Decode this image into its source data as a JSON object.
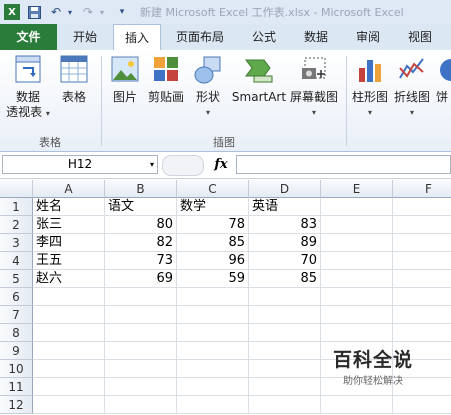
{
  "title_bar": {
    "text": "新建 Microsoft Excel 工作表.xlsx - Microsoft Excel"
  },
  "tabs": [
    "文件",
    "开始",
    "插入",
    "页面布局",
    "公式",
    "数据",
    "审阅",
    "视图"
  ],
  "active_tab": "插入",
  "ribbon": {
    "groups": [
      {
        "name": "表格",
        "buttons": [
          {
            "label": "数据",
            "label2": "透视表",
            "icon": "pivot-table-icon"
          },
          {
            "label": "表格",
            "icon": "table-icon"
          }
        ]
      },
      {
        "name": "插图",
        "buttons": [
          {
            "label": "图片",
            "icon": "picture-icon"
          },
          {
            "label": "剪贴画",
            "icon": "clip-art-icon"
          },
          {
            "label": "形状",
            "icon": "shapes-icon"
          },
          {
            "label": "SmartArt",
            "icon": "smartart-icon"
          },
          {
            "label": "屏幕截图",
            "icon": "screenshot-icon"
          }
        ]
      },
      {
        "name": "",
        "buttons": [
          {
            "label": "柱形图",
            "icon": "column-chart-icon"
          },
          {
            "label": "折线图",
            "icon": "line-chart-icon"
          },
          {
            "label": "饼",
            "icon": "pie-chart-icon"
          }
        ]
      }
    ]
  },
  "formula_bar": {
    "name_box": "H12",
    "fx": "fx",
    "formula": ""
  },
  "sheet": {
    "columns": [
      "A",
      "B",
      "C",
      "D",
      "E",
      "F"
    ],
    "rows": [
      "1",
      "2",
      "3",
      "4",
      "5",
      "6",
      "7",
      "8",
      "9",
      "10",
      "11",
      "12"
    ],
    "cells": [
      [
        "姓名",
        "语文",
        "数学",
        "英语",
        "",
        ""
      ],
      [
        "张三",
        "80",
        "78",
        "83",
        "",
        ""
      ],
      [
        "李四",
        "82",
        "85",
        "89",
        "",
        ""
      ],
      [
        "王五",
        "73",
        "96",
        "70",
        "",
        ""
      ],
      [
        "赵六",
        "69",
        "59",
        "85",
        "",
        ""
      ]
    ]
  },
  "watermark": {
    "title": "百科全说",
    "subtitle": "助你轻松解决"
  }
}
